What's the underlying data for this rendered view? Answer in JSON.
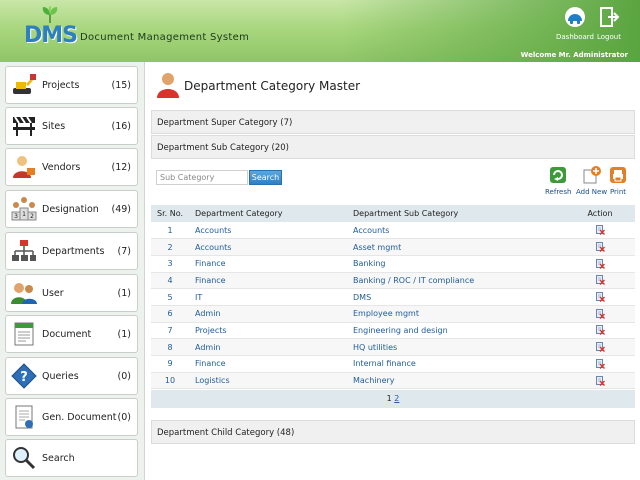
{
  "header": {
    "logo_text": "DMS",
    "app_title": "Document Management System",
    "dashboard_label": "Dashboard",
    "logout_label": "Logout",
    "welcome": "Welcome Mr. Administrator"
  },
  "sidebar": {
    "items": [
      {
        "label": "Projects",
        "count": "(15)",
        "icon": "projects-icon"
      },
      {
        "label": "Sites",
        "count": "(16)",
        "icon": "sites-icon"
      },
      {
        "label": "Vendors",
        "count": "(12)",
        "icon": "vendors-icon"
      },
      {
        "label": "Designation",
        "count": "(49)",
        "icon": "designation-icon"
      },
      {
        "label": "Departments",
        "count": "(7)",
        "icon": "departments-icon"
      },
      {
        "label": "User",
        "count": "(1)",
        "icon": "user-icon"
      },
      {
        "label": "Document",
        "count": "(1)",
        "icon": "document-icon"
      },
      {
        "label": "Queries",
        "count": "(0)",
        "icon": "queries-icon"
      },
      {
        "label": "Gen. Document",
        "count": "(0)",
        "icon": "gen-document-icon"
      },
      {
        "label": "Search",
        "count": "",
        "icon": "search-icon"
      }
    ]
  },
  "main": {
    "title": "Department Category Master",
    "super_category": "Department Super Category (7)",
    "sub_category": "Department Sub Category (20)",
    "child_category": "Department Child Category (48)",
    "search_placeholder": "Sub Category",
    "search_label": "Search",
    "toolbar": {
      "refresh": "Refresh",
      "add_new": "Add New",
      "print": "Print"
    },
    "table": {
      "headers": {
        "sr": "Sr. No.",
        "category": "Department Category",
        "sub": "Department Sub Category",
        "action": "Action"
      },
      "rows": [
        {
          "sr": "1",
          "category": "Accounts",
          "sub": "Accounts"
        },
        {
          "sr": "2",
          "category": "Accounts",
          "sub": "Asset mgmt"
        },
        {
          "sr": "3",
          "category": "Finance",
          "sub": "Banking"
        },
        {
          "sr": "4",
          "category": "Finance",
          "sub": "Banking / ROC / IT compliance"
        },
        {
          "sr": "5",
          "category": "IT",
          "sub": "DMS"
        },
        {
          "sr": "6",
          "category": "Admin",
          "sub": "Employee mgmt"
        },
        {
          "sr": "7",
          "category": "Projects",
          "sub": "Engineering and design"
        },
        {
          "sr": "8",
          "category": "Admin",
          "sub": "HQ utilities"
        },
        {
          "sr": "9",
          "category": "Finance",
          "sub": "Internal finance"
        },
        {
          "sr": "10",
          "category": "Logistics",
          "sub": "Machinery"
        }
      ]
    },
    "pager": {
      "current": "1",
      "next": "2"
    }
  },
  "colors": {
    "accent": "#2f7fc2",
    "header_green": "#8fc566",
    "link": "#1f5c99"
  }
}
